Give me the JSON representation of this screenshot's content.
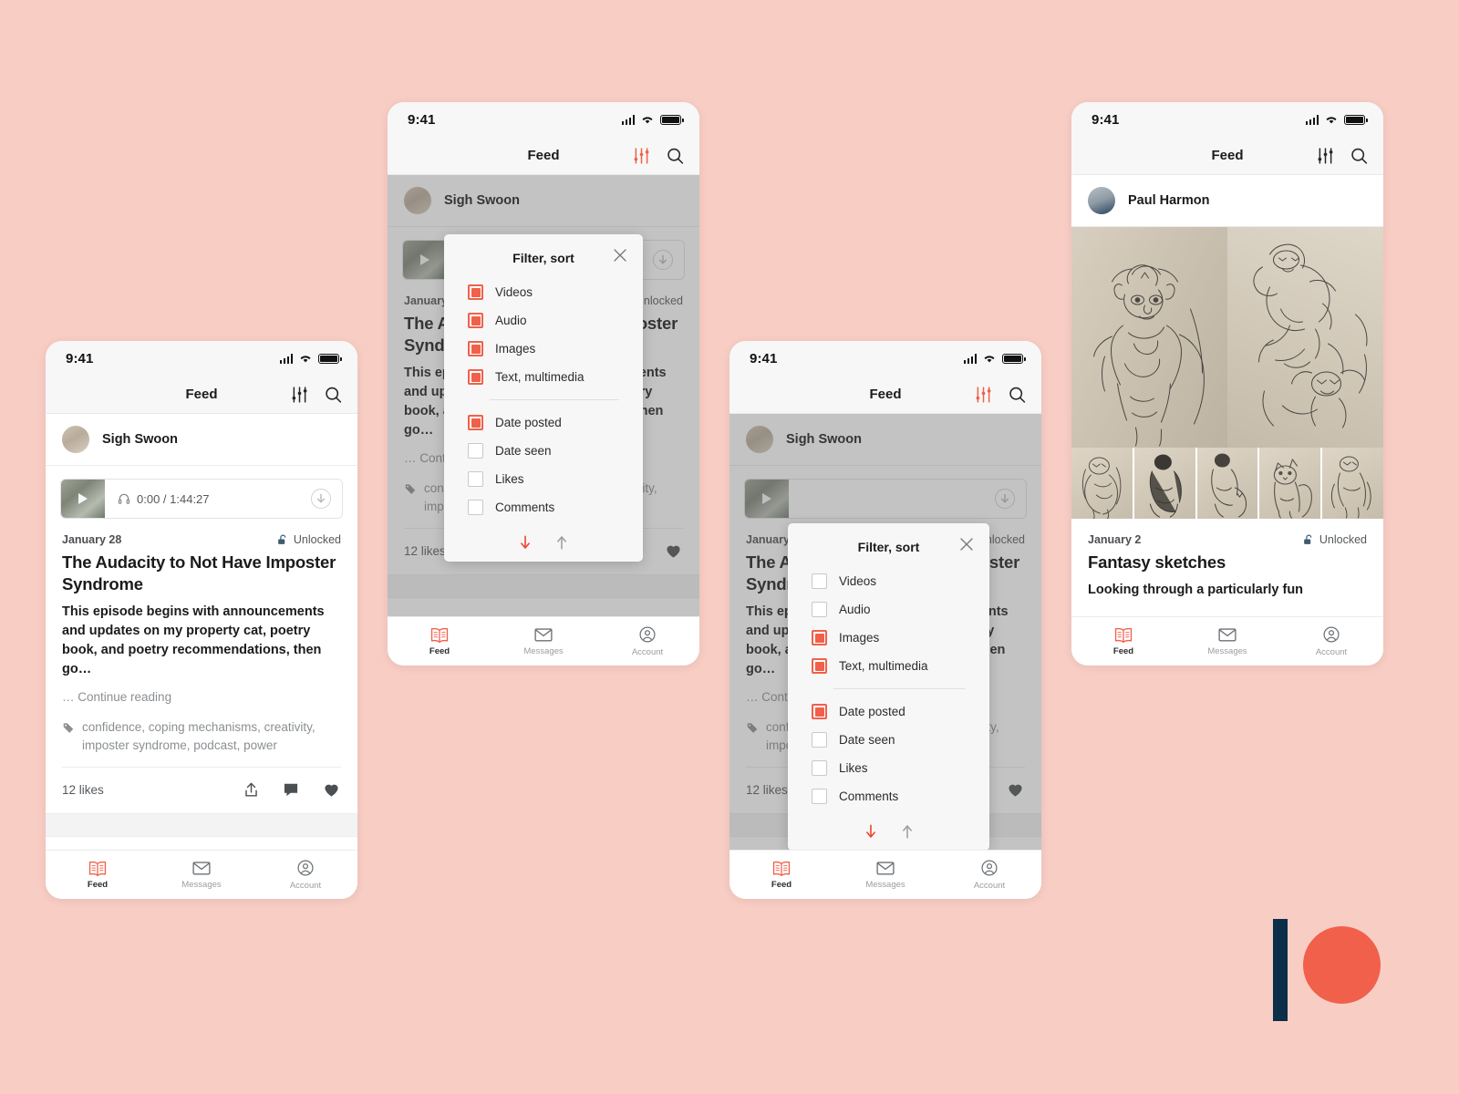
{
  "background_color": "#f8cdc4",
  "accent_color": "#f0604a",
  "logo": {
    "bar_color": "#0b2e49",
    "dot_color": "#f0604a",
    "name": "patreon-logo"
  },
  "status_bar": {
    "time": "9:41",
    "icons": [
      "cellular-signal-icon",
      "wifi-icon",
      "battery-icon"
    ]
  },
  "nav": {
    "title": "Feed",
    "filter_icon": "sliders-icon",
    "search_icon": "search-icon"
  },
  "tabbar": {
    "items": [
      {
        "label": "Feed",
        "icon": "open-book-icon",
        "active": true
      },
      {
        "label": "Messages",
        "icon": "envelope-icon",
        "active": false
      },
      {
        "label": "Account",
        "icon": "user-circle-icon",
        "active": false
      }
    ]
  },
  "dialog": {
    "title": "Filter, sort",
    "close_icon": "close-icon",
    "sort_desc_icon": "arrow-down-icon",
    "sort_asc_icon": "arrow-up-icon",
    "media_options": [
      "Videos",
      "Audio",
      "Images",
      "Text, multimedia"
    ],
    "sort_options": [
      "Date posted",
      "Date seen",
      "Likes",
      "Comments"
    ]
  },
  "phones": [
    {
      "id": "phone-feed-default",
      "filter_icon_active": false,
      "post": {
        "author": "Sigh Swoon",
        "player": {
          "time": "0:00 / 1:44:27",
          "headphones_icon": "headphones-icon",
          "download_icon": "download-icon",
          "play_icon": "play-icon"
        },
        "date": "January 28",
        "lock_status": "Unlocked",
        "lock_icon": "unlock-icon",
        "title": "The Audacity to Not Have Imposter Syndrome",
        "body": "This episode begins with announcements and updates on my property cat, poetry book, and poetry recommendations, then go…",
        "continue": "… Continue reading",
        "tags_icon": "tag-icon",
        "tags": "confidence, coping mechanisms, creativity, imposter syndrome, podcast, power",
        "likes": "12 likes",
        "actions": [
          "share-icon",
          "comment-icon",
          "heart-icon"
        ]
      }
    },
    {
      "id": "phone-filter-all-checked",
      "filter_icon_active": true,
      "media_checked": [
        true,
        true,
        true,
        true
      ],
      "sort_checked": [
        true,
        false,
        false,
        false
      ],
      "sort_direction": "desc"
    },
    {
      "id": "phone-filter-partial-checked",
      "filter_icon_active": true,
      "media_checked": [
        false,
        false,
        true,
        true
      ],
      "sort_checked": [
        true,
        false,
        false,
        false
      ],
      "sort_direction": "desc"
    },
    {
      "id": "phone-feed-images",
      "filter_icon_active": false,
      "post": {
        "author": "Paul Harmon",
        "date": "January 2",
        "lock_status": "Unlocked",
        "lock_icon": "unlock-icon",
        "title": "Fantasy sketches",
        "body": "Looking through a particularly fun"
      }
    }
  ]
}
